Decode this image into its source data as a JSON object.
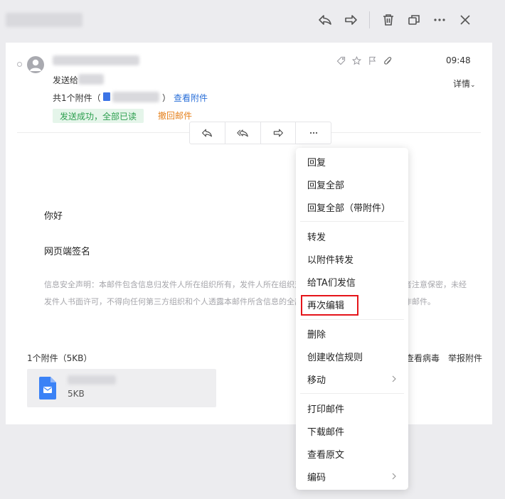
{
  "toolbar": {
    "icons": [
      "reply-icon",
      "forward-icon",
      "delete-icon",
      "new-window-icon",
      "more-icon",
      "close-icon"
    ]
  },
  "mail": {
    "send_to_label": "发送给",
    "attachment_prefix": "共1个附件（",
    "attachment_suffix": "）",
    "view_attachment": "查看附件",
    "status": "发送成功，全部已读",
    "recall": "撤回邮件",
    "time": "09:48",
    "details": "详情"
  },
  "body": {
    "greeting": "你好",
    "signature": "网页端签名",
    "disclaimer": "信息安全声明：本邮件包含信息归发件人所在组织所有，发件人所在组织对该邮件拥有所有权利。请接收者注意保密，未经发件人书面许可，不得向任何第三方组织和个人透露本邮件所含信息的全部或部分。以上声明仅适用于工作邮件。"
  },
  "attachment": {
    "count_label": "1个附件（5KB）",
    "scan_label": "查看病毒",
    "report_label": "举报附件",
    "size": "5KB"
  },
  "menu": {
    "items": [
      {
        "label": "回复"
      },
      {
        "label": "回复全部"
      },
      {
        "label": "回复全部（带附件）"
      },
      {
        "label": "转发"
      },
      {
        "label": "以附件转发"
      },
      {
        "label": "给TA们发信"
      },
      {
        "label": "再次编辑"
      },
      {
        "label": "删除"
      },
      {
        "label": "创建收信规则"
      },
      {
        "label": "移动"
      },
      {
        "label": "打印邮件"
      },
      {
        "label": "下载邮件"
      },
      {
        "label": "查看原文"
      },
      {
        "label": "编码"
      }
    ]
  },
  "colors": {
    "link": "#2a6fd8",
    "success_bg": "#e5f5ea",
    "success_text": "#2d9f4f",
    "recall": "#e5801b",
    "highlight": "#e5151a"
  }
}
